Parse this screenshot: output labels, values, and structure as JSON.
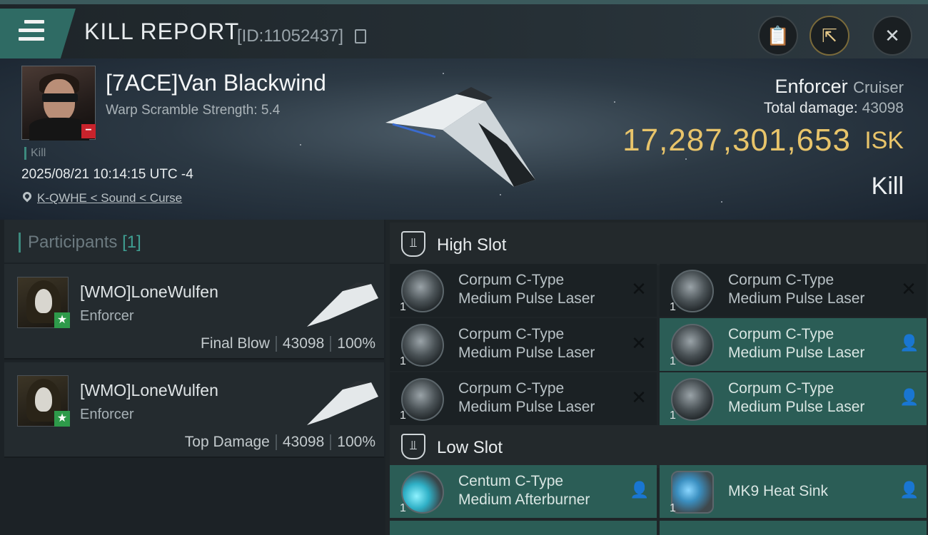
{
  "header": {
    "title": "KILL REPORT",
    "report_id": "[ID:11052437]",
    "buttons": [
      "clipboard-icon",
      "share-icon",
      "close-icon"
    ]
  },
  "victim": {
    "name": "[7ACE]Van Blackwind",
    "warp_scramble": "Warp Scramble Strength: 5.4",
    "kill_tag": "Kill",
    "datetime": "2025/08/21 10:14:15 UTC -4",
    "location": "K-QWHE < Sound < Curse",
    "ship_name": "Enforcer",
    "ship_class": "Cruiser",
    "total_damage_label": "Total damage:",
    "total_damage_value": "43098",
    "isk_value": "17,287,301,653",
    "isk_unit": "ISK",
    "result": "Kill"
  },
  "participants": {
    "title": "Participants",
    "count": "[1]",
    "rows": [
      {
        "name": "[WMO]LoneWulfen",
        "ship": "Enforcer",
        "role": "Final Blow",
        "damage": "43098",
        "percent": "100%"
      },
      {
        "name": "[WMO]LoneWulfen",
        "ship": "Enforcer",
        "role": "Top Damage",
        "damage": "43098",
        "percent": "100%"
      }
    ]
  },
  "slots": {
    "high": {
      "title": "High Slot",
      "modules": [
        {
          "line1": "Corpum C-Type",
          "line2": "Medium Pulse Laser",
          "qty": "1",
          "status": "destroyed"
        },
        {
          "line1": "Corpum C-Type",
          "line2": "Medium Pulse Laser",
          "qty": "1",
          "status": "destroyed"
        },
        {
          "line1": "Corpum C-Type",
          "line2": "Medium Pulse Laser",
          "qty": "1",
          "status": "destroyed"
        },
        {
          "line1": "Corpum C-Type",
          "line2": "Medium Pulse Laser",
          "qty": "1",
          "status": "dropped"
        },
        {
          "line1": "Corpum C-Type",
          "line2": "Medium Pulse Laser",
          "qty": "1",
          "status": "destroyed"
        },
        {
          "line1": "Corpum C-Type",
          "line2": "Medium Pulse Laser",
          "qty": "1",
          "status": "dropped"
        }
      ]
    },
    "low": {
      "title": "Low Slot",
      "modules": [
        {
          "line1": "Centum C-Type",
          "line2": "Medium Afterburner",
          "qty": "1",
          "status": "dropped"
        },
        {
          "line1": "MK9 Heat Sink",
          "line2": "",
          "qty": "1",
          "status": "dropped"
        }
      ]
    }
  },
  "status_glyphs": {
    "destroyed": "✕",
    "dropped": "👤"
  },
  "colors": {
    "accent_teal": "#2b5d56",
    "isk_gold": "#e8c46a",
    "loss_red": "#c8232c",
    "ally_green": "#2e9a4a"
  }
}
